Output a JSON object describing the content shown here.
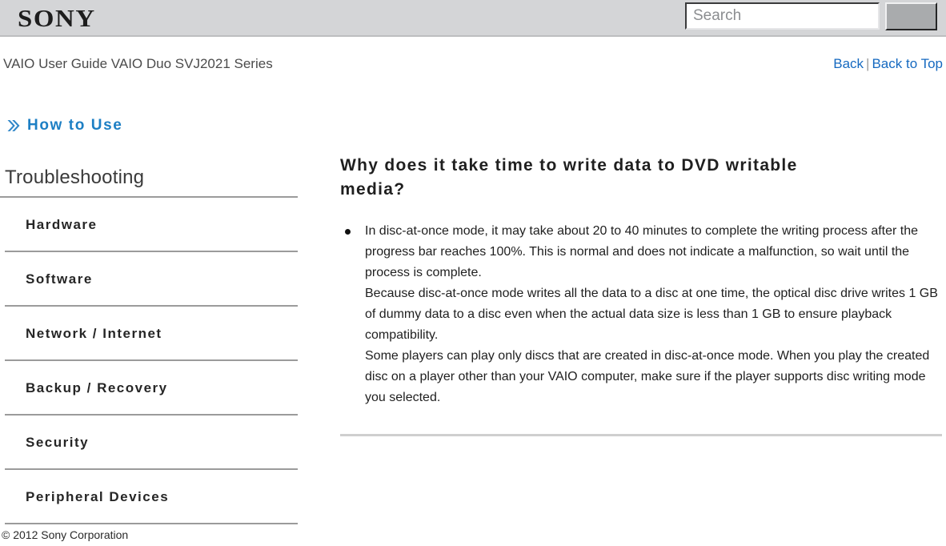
{
  "header": {
    "logo_text": "SONY",
    "search": {
      "placeholder": "Search",
      "value": "",
      "button_label": "",
      "button_icon": "search-icon"
    }
  },
  "subheader": {
    "guide_title": "VAIO User Guide VAIO Duo SVJ2021 Series",
    "back_link": "Back",
    "separator": "|",
    "back_to_top_link": "Back to Top"
  },
  "sidebar": {
    "section_icon": "double-chevron-right-icon",
    "section_label": "How to Use",
    "category_title": "Troubleshooting",
    "items": [
      {
        "label": "Hardware"
      },
      {
        "label": "Software"
      },
      {
        "label": "Network / Internet"
      },
      {
        "label": "Backup / Recovery"
      },
      {
        "label": "Security"
      },
      {
        "label": "Peripheral Devices"
      }
    ]
  },
  "content": {
    "title": "Why does it take time to write data to DVD writable media?",
    "bullets": [
      {
        "paragraphs": [
          "In disc-at-once mode, it may take about 20 to 40 minutes to complete the writing process after the progress bar reaches 100%. This is normal and does not indicate a malfunction, so wait until the process is complete.",
          "Because disc-at-once mode writes all the data to a disc at one time, the optical disc drive writes 1 GB of dummy data to a disc even when the actual data size is less than 1 GB to ensure playback compatibility.",
          "Some players can play only discs that are created in disc-at-once mode. When you play the created disc on a player other than your VAIO computer, make sure if the player supports disc writing mode you selected."
        ]
      }
    ]
  },
  "footer": {
    "copyright": "© 2012 Sony Corporation"
  },
  "colors": {
    "header_bg": "#d4d5d7",
    "link_blue": "#1569c0",
    "accent_blue": "#1d7fc4",
    "rule_gray": "#9b9b9b",
    "divider_gray": "#cfcfcf"
  }
}
